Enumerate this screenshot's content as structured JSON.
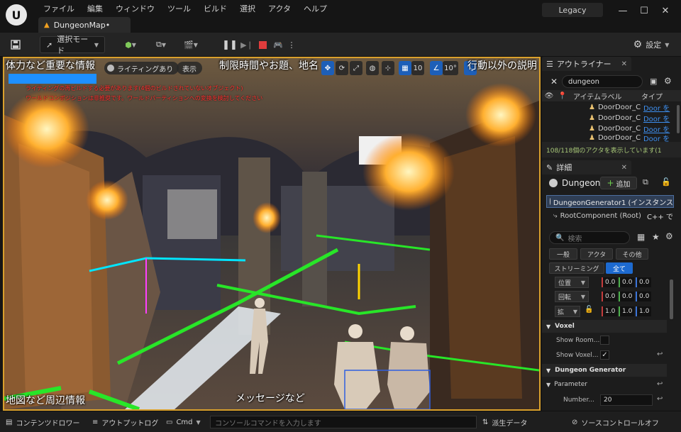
{
  "titlebar": {
    "logo": "U",
    "menus": [
      "ファイル",
      "編集",
      "ウィンドウ",
      "ツール",
      "ビルド",
      "選択",
      "アクタ",
      "ヘルプ"
    ],
    "map_tab": "DungeonMap•",
    "legacy": "Legacy"
  },
  "toolbar": {
    "select_mode": "選択モード",
    "settings": "設定"
  },
  "viewport": {
    "lighting": "ライティングあり",
    "show": "表示",
    "grid_value": "10",
    "angle_value": "10°",
    "overlay_top_left": "体力など重要な情報",
    "overlay_top_center": "制限時間やお題、地名",
    "overlay_top_right": "行動以外の説明",
    "overlay_bottom_left": "地図など周辺情報",
    "overlay_bottom_center": "メッセージなど",
    "warning_1": "ライティングの再ビルドする必要があります(4個のビルドされていないオブジェクト)",
    "warning_2": "ワールドコンポジションは非推奨です。ワールドパーティションへの変換を検討してください",
    "progress": 1.0
  },
  "outliner": {
    "tab": "アウトライナー",
    "search": "dungeon",
    "col_label": "アイテムラベル",
    "col_type": "タイプ",
    "rows": [
      {
        "name": "DoorDoor_C",
        "type": "Door を"
      },
      {
        "name": "DoorDoor_C",
        "type": "Door を"
      },
      {
        "name": "DoorDoor_C",
        "type": "Door を"
      },
      {
        "name": "DoorDoor_C",
        "type": "Door を"
      }
    ],
    "status": "108/118個のアクタを表示しています(1"
  },
  "details": {
    "tab": "詳細",
    "actor_name": "Dungeon",
    "add": "追加",
    "instance": "DungeonGenerator1 (インスタンス",
    "root": "RootComponent (Root)",
    "cpp": "C++ で",
    "search_placeholder": "検索",
    "filters": [
      "一般",
      "アクタ",
      "その他",
      "ストリーミング",
      "全て"
    ],
    "location_label": "位置",
    "rotation_label": "回転",
    "scale_label": "拡",
    "location": [
      "0.0",
      "0.0",
      "0.0"
    ],
    "rotation": [
      "0.0",
      "0.0",
      "0.0"
    ],
    "scale": [
      "1.0",
      "1.0",
      "1.0"
    ],
    "section_voxel": "Voxel",
    "show_room": "Show Room...",
    "show_voxel": "Show Voxel...",
    "section_generator": "Dungeon Generator",
    "parameter": "Parameter",
    "number_label": "Number...",
    "number_value": "20"
  },
  "bottombar": {
    "content_drawer": "コンテンツドロワー",
    "output_log": "アウトプットログ",
    "cmd": "Cmd",
    "console_placeholder": "コンソールコマンドを入力します",
    "derived_data": "派生データ",
    "source_control": "ソースコントロールオフ"
  }
}
